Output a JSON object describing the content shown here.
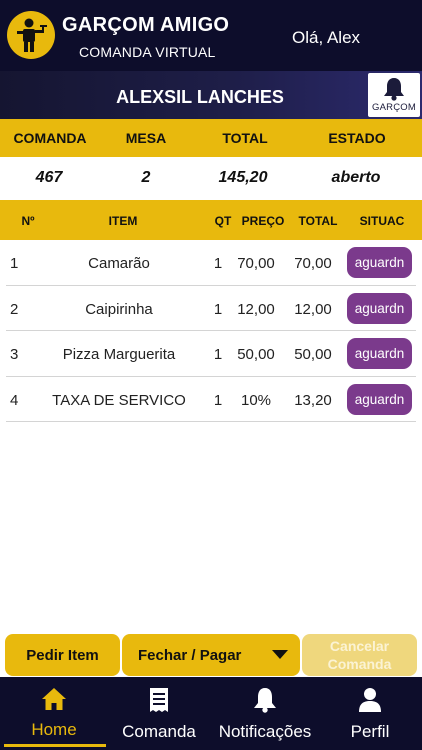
{
  "app": {
    "title": "GARÇOM AMIGO",
    "subtitle": "COMANDA VIRTUAL",
    "greeting": "Olá, Alex",
    "logo_icon": "waiter-logo-icon"
  },
  "restaurant": {
    "name": "ALEXSIL LANCHES",
    "waiter_button_label": "GARÇOM",
    "waiter_button_icon": "bell-icon"
  },
  "summary": {
    "headers": {
      "comanda": "COMANDA",
      "mesa": "MESA",
      "total": "TOTAL",
      "estado": "ESTADO"
    },
    "values": {
      "comanda": "467",
      "mesa": "2",
      "total": "145,20",
      "estado": "aberto"
    }
  },
  "items_table": {
    "headers": {
      "num": "Nº",
      "item": "ITEM",
      "qt": "QT",
      "preco": "PREÇO",
      "total": "TOTAL",
      "situacao": "SITUAC"
    },
    "rows": [
      {
        "num": "1",
        "item": "Camarão",
        "qt": "1",
        "preco": "70,00",
        "total": "70,00",
        "status": "aguardn"
      },
      {
        "num": "2",
        "item": "Caipirinha",
        "qt": "1",
        "preco": "12,00",
        "total": "12,00",
        "status": "aguardn"
      },
      {
        "num": "3",
        "item": "Pizza Marguerita",
        "qt": "1",
        "preco": "50,00",
        "total": "50,00",
        "status": "aguardn"
      },
      {
        "num": "4",
        "item": "TAXA DE SERVICO",
        "qt": "1",
        "preco": "10%",
        "total": "13,20",
        "status": "aguardn"
      }
    ]
  },
  "actions": {
    "order_item": "Pedir Item",
    "close_pay": "Fechar / Pagar",
    "cancel": "Cancelar Comanda"
  },
  "nav": {
    "items": [
      {
        "label": "Home",
        "icon": "home-icon",
        "active": true
      },
      {
        "label": "Comanda",
        "icon": "receipt-icon",
        "active": false
      },
      {
        "label": "Notificações",
        "icon": "bell-icon",
        "active": false
      },
      {
        "label": "Perfil",
        "icon": "person-icon",
        "active": false
      }
    ]
  },
  "colors": {
    "header_bg": "#0d0d2b",
    "accent_yellow": "#e8b90d",
    "status_purple": "#7b3a8c",
    "disabled_yellow": "#efd77d"
  }
}
